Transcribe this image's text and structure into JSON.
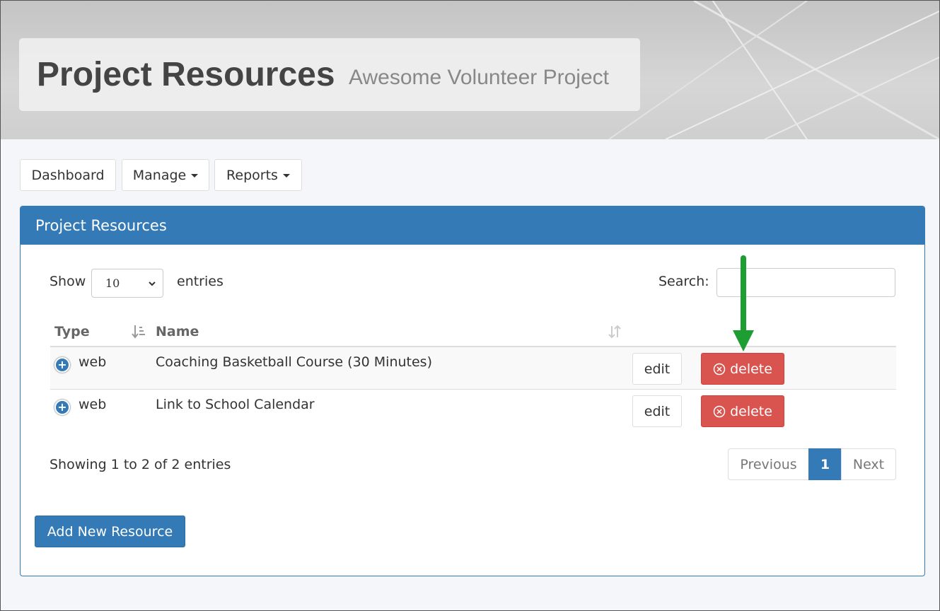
{
  "header": {
    "title": "Project Resources",
    "subtitle": "Awesome Volunteer Project"
  },
  "nav": {
    "dashboard": "Dashboard",
    "manage": "Manage",
    "reports": "Reports"
  },
  "panel": {
    "heading": "Project Resources",
    "show_label": "Show",
    "entries_per_page": "10",
    "entries_label": "entries",
    "search_label": "Search:",
    "search_value": ""
  },
  "table": {
    "columns": [
      "Type",
      "Name"
    ],
    "rows": [
      {
        "type": "web",
        "name": "Coaching Basketball Course (30 Minutes)",
        "edit": "edit",
        "delete": "delete"
      },
      {
        "type": "web",
        "name": "Link to School Calendar",
        "edit": "edit",
        "delete": "delete"
      }
    ]
  },
  "footer": {
    "info": "Showing 1 to 2 of 2 entries",
    "pagination": {
      "previous": "Previous",
      "current": "1",
      "next": "Next"
    },
    "add_button": "Add New Resource"
  },
  "icons": {
    "expand": "plus-circle-icon",
    "delete": "x-circle-icon",
    "sort": "sort-icon",
    "dropdown": "caret-down-icon",
    "annotation": "green-arrow-icon"
  },
  "colors": {
    "primary": "#337ab7",
    "danger": "#d9534f",
    "annotation": "#1e9e32"
  }
}
